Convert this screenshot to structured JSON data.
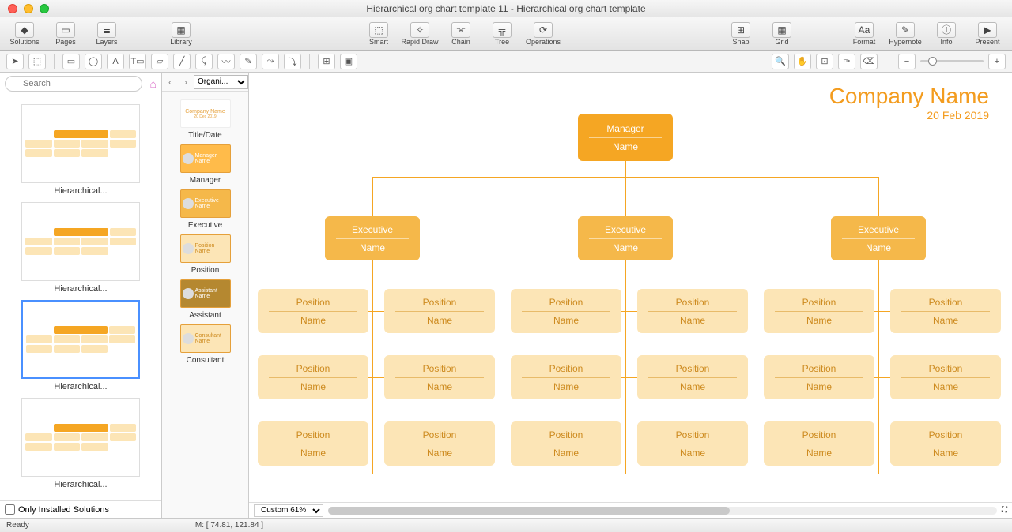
{
  "window": {
    "title": "Hierarchical org chart template 11 - Hierarchical org chart template"
  },
  "toolbar": {
    "solutions": "Solutions",
    "pages": "Pages",
    "layers": "Layers",
    "library": "Library",
    "smart": "Smart",
    "rapid_draw": "Rapid Draw",
    "chain": "Chain",
    "tree": "Tree",
    "operations": "Operations",
    "snap": "Snap",
    "grid": "Grid",
    "format": "Format",
    "hypernote": "Hypernote",
    "info": "Info",
    "present": "Present"
  },
  "search": {
    "placeholder": "Search"
  },
  "thumbs": {
    "t1": "Hierarchical...",
    "t2": "Hierarchical...",
    "t3": "Hierarchical...",
    "t4": "Hierarchical..."
  },
  "only_installed": "Only Installed Solutions",
  "library": {
    "selector": "Organi...",
    "title_date_item": {
      "line1": "Company Name",
      "line2": "20 Dec 2019",
      "label": "Title/Date"
    },
    "manager_item": {
      "box_title": "Manager",
      "box_sub": "Name",
      "label": "Manager"
    },
    "executive_item": {
      "box_title": "Executive",
      "box_sub": "Name",
      "label": "Executive"
    },
    "position_item": {
      "box_title": "Position",
      "box_sub": "Name",
      "label": "Position"
    },
    "assistant_item": {
      "box_title": "Assistant",
      "box_sub": "Name",
      "label": "Assistant"
    },
    "consultant_item": {
      "box_title": "Consultant",
      "box_sub": "Name",
      "label": "Consultant"
    }
  },
  "canvas": {
    "company_name": "Company Name",
    "date": "20 Feb 2019",
    "manager": {
      "title": "Manager",
      "name": "Name"
    },
    "exec": {
      "title": "Executive",
      "name": "Name"
    },
    "pos": {
      "title": "Position",
      "name": "Name"
    }
  },
  "zoom": {
    "label": "Custom 61%"
  },
  "status": {
    "ready": "Ready",
    "mouse": "M: [ 74.81, 121.84 ]"
  }
}
